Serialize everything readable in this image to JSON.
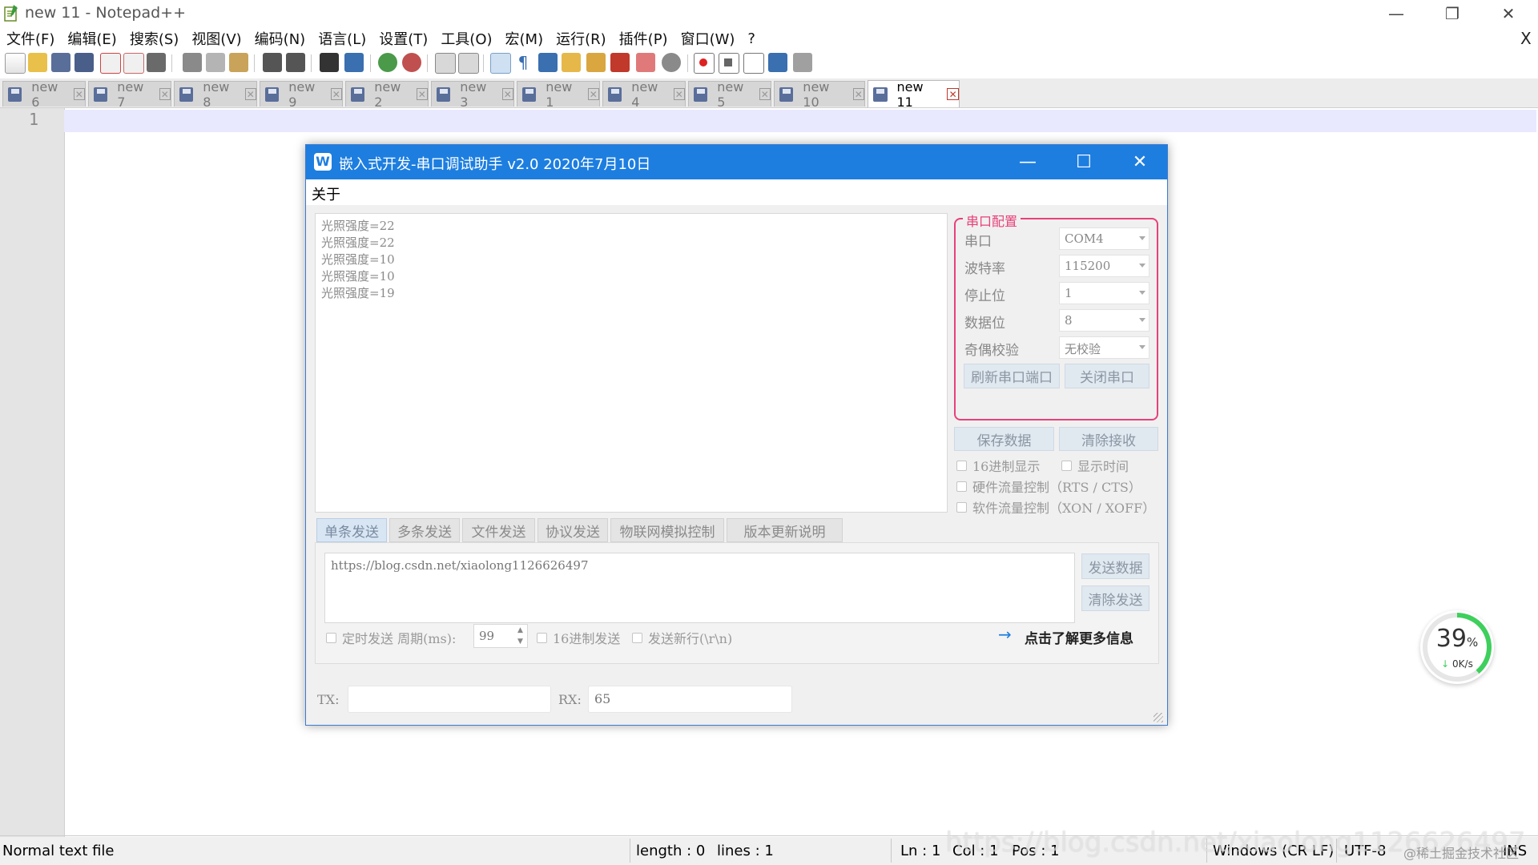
{
  "app": {
    "title": "new 11 - Notepad++",
    "menu": [
      "文件(F)",
      "编辑(E)",
      "搜索(S)",
      "视图(V)",
      "编码(N)",
      "语言(L)",
      "设置(T)",
      "工具(O)",
      "宏(M)",
      "运行(R)",
      "插件(P)",
      "窗口(W)",
      "?"
    ],
    "menu_close": "X",
    "window_controls": {
      "min": "—",
      "max": "❐",
      "close": "✕"
    }
  },
  "tabs": [
    {
      "label": "new 6",
      "active": false
    },
    {
      "label": "new 7",
      "active": false
    },
    {
      "label": "new 8",
      "active": false
    },
    {
      "label": "new 9",
      "active": false
    },
    {
      "label": "new 2",
      "active": false
    },
    {
      "label": "new 3",
      "active": false
    },
    {
      "label": "new 1",
      "active": false
    },
    {
      "label": "new 4",
      "active": false
    },
    {
      "label": "new 5",
      "active": false
    },
    {
      "label": "new 10",
      "active": false
    },
    {
      "label": "new 11",
      "active": true
    }
  ],
  "tab_close": "✕",
  "editor": {
    "line_number": "1"
  },
  "statusbar": {
    "file_type": "Normal text file",
    "length": "length : 0",
    "lines": "lines : 1",
    "ln": "Ln : 1",
    "col": "Col : 1",
    "pos": "Pos : 1",
    "eol": "Windows (CR LF)",
    "encoding": "UTF-8",
    "ins": "INS",
    "watermark": "https://blog.csdn.net/xiaolong1126626497",
    "credit": "@稀土掘金技术社区"
  },
  "dialog": {
    "logo": "W",
    "title": "嵌入式开发-串口调试助手 v2.0 2020年7月10日",
    "controls": {
      "min": "—",
      "max": "☐",
      "close": "✕"
    },
    "menu_about": "关于",
    "rx_lines": [
      "光照强度=22",
      "光照强度=22",
      "光照强度=10",
      "光照强度=10",
      "光照强度=19"
    ],
    "config": {
      "legend": "串口配置",
      "port_label": "串口",
      "port_value": "COM4",
      "baud_label": "波特率",
      "baud_value": "115200",
      "stop_label": "停止位",
      "stop_value": "1",
      "data_label": "数据位",
      "data_value": "8",
      "parity_label": "奇偶校验",
      "parity_value": "无校验",
      "refresh_button": "刷新串口端口",
      "close_button": "关闭串口"
    },
    "save_button": "保存数据",
    "clear_rx_button": "清除接收",
    "options": {
      "hex_display": "16进制显示",
      "show_time": "显示时间",
      "hw_flow": "硬件流量控制（RTS / CTS）",
      "sw_flow": "软件流量控制（XON / XOFF）"
    },
    "send_tabs": [
      "单条发送",
      "多条发送",
      "文件发送",
      "协议发送",
      "物联网模拟控制",
      "版本更新说明"
    ],
    "send_text": "https://blog.csdn.net/xiaolong1126626497",
    "send_button": "发送数据",
    "clear_send_button": "清除发送",
    "timed_send": "定时发送 周期(ms):",
    "period_value": "99",
    "hex_send": "16进制发送",
    "send_newline": "发送新行(\\r\\n)",
    "more_info": "点击了解更多信息",
    "tx_label": "TX:",
    "tx_value": "",
    "rx_label": "RX:",
    "rx_value": "65"
  },
  "net_widget": {
    "percent": 39,
    "percent_sign": "%",
    "speed": "0K/s",
    "download_icon": "↓"
  }
}
